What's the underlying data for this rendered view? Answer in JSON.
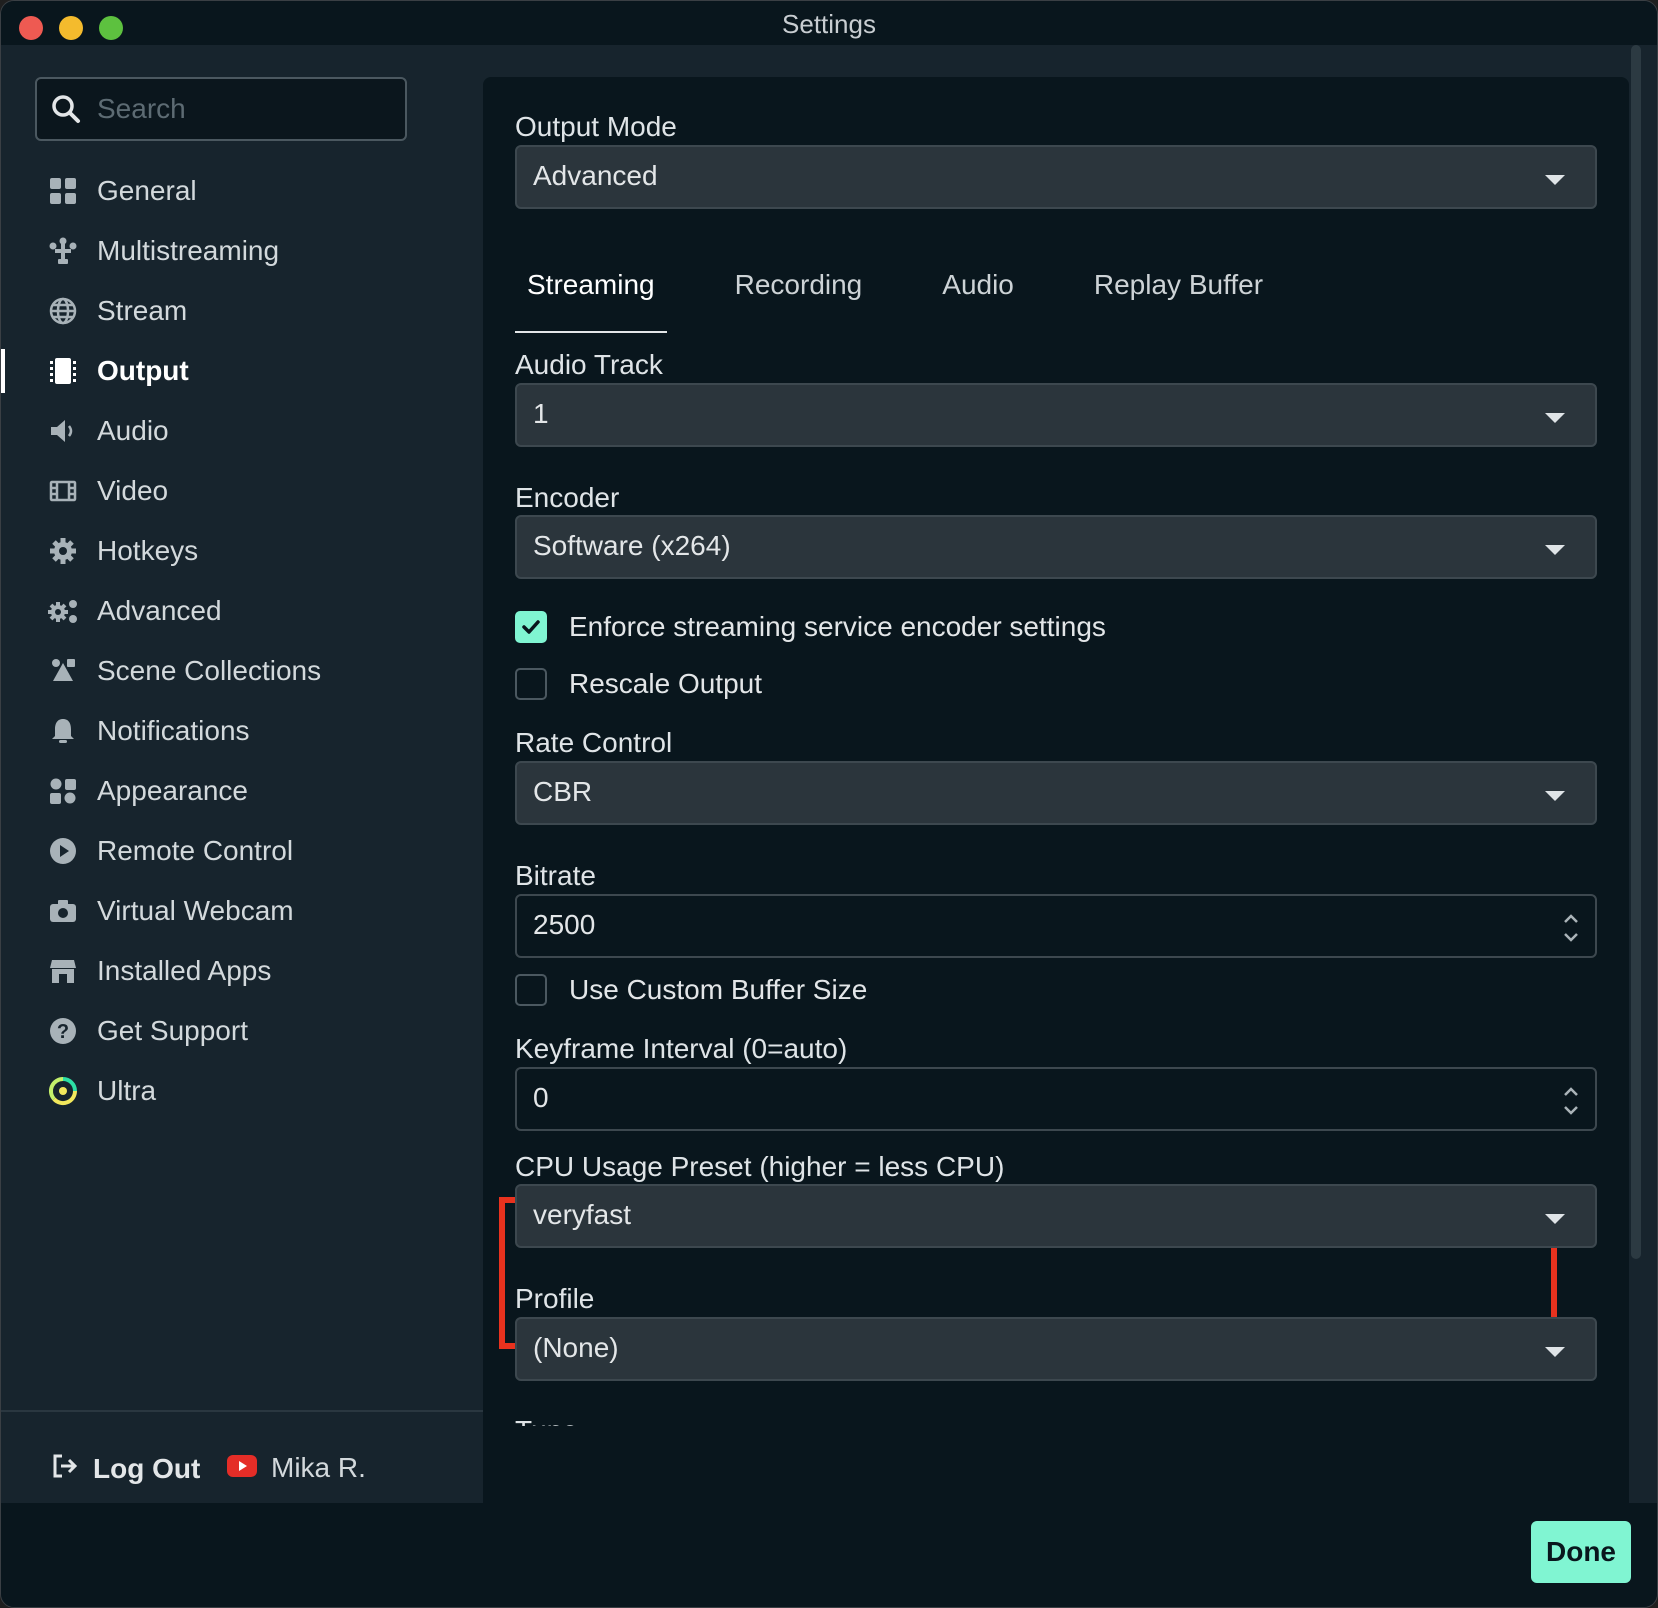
{
  "window": {
    "title": "Settings"
  },
  "search": {
    "placeholder": "Search"
  },
  "sidebar": {
    "items": [
      {
        "label": "General",
        "icon": "grid-icon"
      },
      {
        "label": "Multistreaming",
        "icon": "multistream-icon"
      },
      {
        "label": "Stream",
        "icon": "globe-icon"
      },
      {
        "label": "Output",
        "icon": "output-icon",
        "active": true
      },
      {
        "label": "Audio",
        "icon": "speaker-icon"
      },
      {
        "label": "Video",
        "icon": "film-icon"
      },
      {
        "label": "Hotkeys",
        "icon": "gear-icon"
      },
      {
        "label": "Advanced",
        "icon": "gears-icon"
      },
      {
        "label": "Scene Collections",
        "icon": "scene-collections-icon"
      },
      {
        "label": "Notifications",
        "icon": "bell-icon"
      },
      {
        "label": "Appearance",
        "icon": "appearance-icon"
      },
      {
        "label": "Remote Control",
        "icon": "play-circle-icon"
      },
      {
        "label": "Virtual Webcam",
        "icon": "camera-icon"
      },
      {
        "label": "Installed Apps",
        "icon": "store-icon"
      },
      {
        "label": "Get Support",
        "icon": "question-icon"
      },
      {
        "label": "Ultra",
        "icon": "ultra-icon"
      }
    ],
    "footer": {
      "logout_label": "Log Out",
      "user_name": "Mika R."
    }
  },
  "main": {
    "output_mode": {
      "label": "Output Mode",
      "value": "Advanced"
    },
    "tabs": [
      {
        "label": "Streaming",
        "active": true
      },
      {
        "label": "Recording"
      },
      {
        "label": "Audio"
      },
      {
        "label": "Replay Buffer"
      }
    ],
    "audio_track": {
      "label": "Audio Track",
      "value": "1"
    },
    "encoder": {
      "label": "Encoder",
      "value": "Software (x264)"
    },
    "enforce_encoder": {
      "label": "Enforce streaming service encoder settings",
      "checked": true
    },
    "rescale_output": {
      "label": "Rescale Output",
      "checked": false
    },
    "rate_control": {
      "label": "Rate Control",
      "value": "CBR"
    },
    "bitrate": {
      "label": "Bitrate",
      "value": "2500"
    },
    "custom_buffer": {
      "label": "Use Custom Buffer Size",
      "checked": false
    },
    "keyframe_interval": {
      "label": "Keyframe Interval (0=auto)",
      "value": "0"
    },
    "cpu_preset": {
      "label": "CPU Usage Preset (higher = less CPU)",
      "value": "veryfast"
    },
    "profile": {
      "label": "Profile",
      "value": "(None)"
    },
    "tune": {
      "label": "Tune"
    }
  },
  "buttons": {
    "done": "Done"
  },
  "colors": {
    "accent": "#80f5d2",
    "highlight": "#e8321e",
    "background": "#09161d",
    "sidebar": "#17242d"
  }
}
